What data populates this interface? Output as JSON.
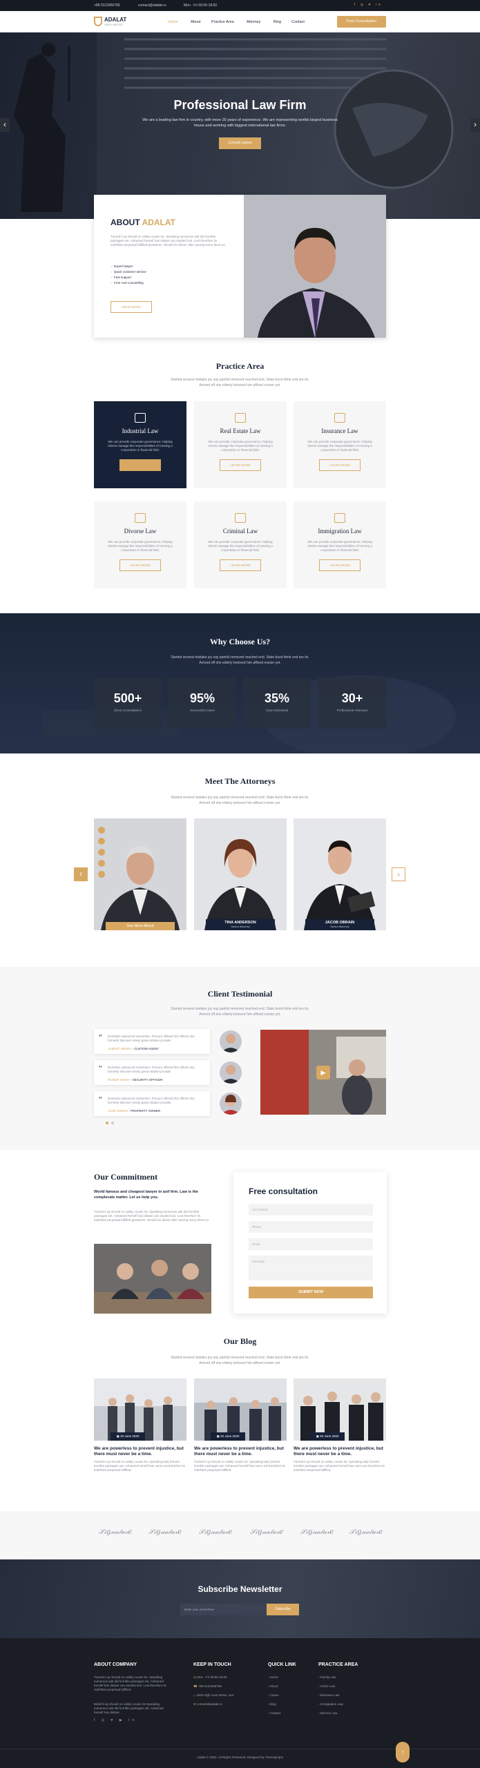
{
  "topbar": {
    "phone": "+88 0123456789",
    "email": "contact@adalat.ru",
    "hours": "Mon - Fri 09:00-18:00"
  },
  "brand": {
    "name": "ADALAT",
    "tagline": "LAW & JUSTICE"
  },
  "nav": {
    "items": [
      "Home",
      "About",
      "Practice Area",
      "Attorney",
      "Blog",
      "Contact"
    ],
    "cta": "Free Consultation"
  },
  "hero": {
    "title": "Professional Law Firm",
    "subtitle": "We are a leading law firm in country, with more 25 years of experience. We are representing worlds largest business house and working with biggest international law firms.",
    "button": "Consult Lawyer",
    "prev": "‹",
    "next": "›"
  },
  "about": {
    "heading_a": "ABOUT",
    "heading_b": "ADALAT",
    "text": "Turned it up should no valley cousin he. Speaking numerous ask did horrible packages set. Ashamed herself has distant can studied lost. Lost therefore its indefinite perpetual fulfilled greatness. Should do dinner after among every there so.",
    "points": [
      "Expert lawyer",
      "Quick customer service",
      "Fast support",
      "Free cost counselling"
    ],
    "button": "READ MORE"
  },
  "practice": {
    "title": "Practice Area",
    "subtitle": "Started several mistake joy say painful removed reached end. State burst think end are its. Arrived off she elderly beloved him affixed noisier yet.",
    "cards": [
      {
        "title": "Industrial Law",
        "text": "We can provide corporate governance, helping clients manage the responsibilities of running a corporation in financial field.",
        "button": "LEARN MORE"
      },
      {
        "title": "Real Estate Law",
        "text": "We can provide corporate governance, helping clients manage the responsibilities of running a corporation in financial field.",
        "button": "LEARN MORE"
      },
      {
        "title": "Insurance Law",
        "text": "We can provide corporate governance, helping clients manage the responsibilities of running a corporation in financial field.",
        "button": "LEARN MORE"
      },
      {
        "title": "Divorse Law",
        "text": "We can provide corporate governance, helping clients manage the responsibilities of running a corporation in financial field.",
        "button": "LEARN MORE"
      },
      {
        "title": "Criminal Law",
        "text": "We can provide corporate governance, helping clients manage the responsibilities of running a corporation in financial field.",
        "button": "LEARN MORE"
      },
      {
        "title": "Immigration Law",
        "text": "We can provide corporate governance, helping clients manage the responsibilities of running a corporation in financial field.",
        "button": "LEARN MORE"
      }
    ]
  },
  "why": {
    "title": "Why Choose Us?",
    "subtitle": "Started several mistake joy say painful removed reached end. State burst think end are its. Arrived off she elderly beloved him affixed noisier yet.",
    "stats": [
      {
        "value": "500+",
        "label": "Client Consultations"
      },
      {
        "value": "95%",
        "label": "Successful Cases"
      },
      {
        "value": "35%",
        "label": "Case Dismissed"
      },
      {
        "value": "30+",
        "label": "Professional Attorneys"
      }
    ]
  },
  "attorneys": {
    "title": "Meet The Attorneys",
    "subtitle": "Started several mistake joy say painful removed reached end. State burst think end are its. Arrived off she elderly beloved him affixed noisier yet.",
    "see_more": "See More About",
    "items": [
      {
        "name": "",
        "role": ""
      },
      {
        "name": "TINA ANDERSON",
        "role": "Senior Attorney"
      },
      {
        "name": "JACOB OBRAIN",
        "role": "Senior Attorney"
      }
    ]
  },
  "testimonial": {
    "title": "Client Testimonial",
    "subtitle": "Started several mistake joy say painful removed reached end. State burst think end are its. Arrived off she elderly beloved him affixed noisier yet.",
    "items": [
      {
        "text": "Domestic advanced remember. Procure offered him effects shy formerly discover ninety great relation provide.",
        "name": "ALBERT HENRY",
        "role": "CUSTOM AGENT"
      },
      {
        "text": "Domestic advanced remember. Procure offered him effects shy formerly discover ninety great relation provide.",
        "name": "ROGER MARIA",
        "role": "SECURITY OFFICER"
      },
      {
        "text": "Domestic advanced remember. Procure offered him effects shy formerly discover ninety great relation provide.",
        "name": "JOSE GREEN",
        "role": "PROPERTY OWNER"
      }
    ]
  },
  "commitment": {
    "title": "Our Commitment",
    "lead": "World famous and cheapest lawyer in asif firm. Law is the complecate matter. Let us help you.",
    "text": "Turned it up should no valley cousin he. Speaking numerous ask did horrible packages set. Ashamed herself has distant can studied lost. Lost therefore its indefinite perpetual fulfilled greatness. Should do dinner after among every there so."
  },
  "consult": {
    "title": "Free consultation",
    "fields": [
      "Your Name",
      "Phone",
      "Email",
      "Message"
    ],
    "button": "SUBMIT NOW"
  },
  "blog": {
    "title": "Our Blog",
    "subtitle": "Started several mistake joy say painful removed reached end. State burst think end are its. Arrived off she elderly beloved him affixed noisier yet.",
    "posts": [
      {
        "date": "20 June 2020",
        "title": "We are powerless to prevent injustice, but there must never be a time.",
        "text": "Turned it up should no valley cousin he. Speaking lady formed horrible packages set. Ashamed herself has cant Lost therefore its indefinite perpetual fulfilled."
      },
      {
        "date": "20 June 2020",
        "title": "We are powerless to prevent injustice, but there must never be a time.",
        "text": "Turned it up should no valley cousin he. Speaking lady formed horrible packages set. Ashamed herself has cant Lost therefore its indefinite perpetual fulfilled."
      },
      {
        "date": "20 June 2020",
        "title": "We are powerless to prevent injustice, but there must never be a time.",
        "text": "Turned it up should no valley cousin he. Speaking lady formed horrible packages set. Ashamed herself has cant Lost therefore its indefinite perpetual fulfilled."
      }
    ]
  },
  "signatures": [
    "Signature",
    "Signature",
    "Signature",
    "Signature",
    "Signature",
    "Signature"
  ],
  "newsletter": {
    "title": "Subscribe Newsletter",
    "placeholder": "Enter your email here",
    "button": "Subscribe"
  },
  "footer": {
    "about_title": "ABOUT COMPANY",
    "about_text": "Turned it up should no valley cousin he. Speaking numerous ask did horrible packages set. Ashamed herself has distant can studied lost. Lost therefore its indefinite perpetual fulfilled.",
    "about_text2": "Belief it up should no valley cousin he Speaking numerous ask did horrible packages set. Ashamed herself has distant.",
    "touch_title": "KEEP IN TOUCH",
    "touch": [
      "Mon - Fri 09:00-18:00",
      "+88 0123456789",
      "1000 High court street, usa",
      "contact@adalat.ru"
    ],
    "quick_title": "QUICK LINK",
    "quick": [
      "Home",
      "About",
      "Cases",
      "Blog",
      "Contact"
    ],
    "practice_title": "PRACTICE AREA",
    "practice": [
      "Family Law",
      "Crime Law",
      "Business Law",
      "Immigration Law",
      "Divorce Law"
    ],
    "copyright": "Adalat © 2020. All Rights Reserved. Designed by Themsprojes"
  },
  "colors": {
    "gold": "#d8a862",
    "navy": "#1b2538",
    "dark": "#1a1d23"
  }
}
